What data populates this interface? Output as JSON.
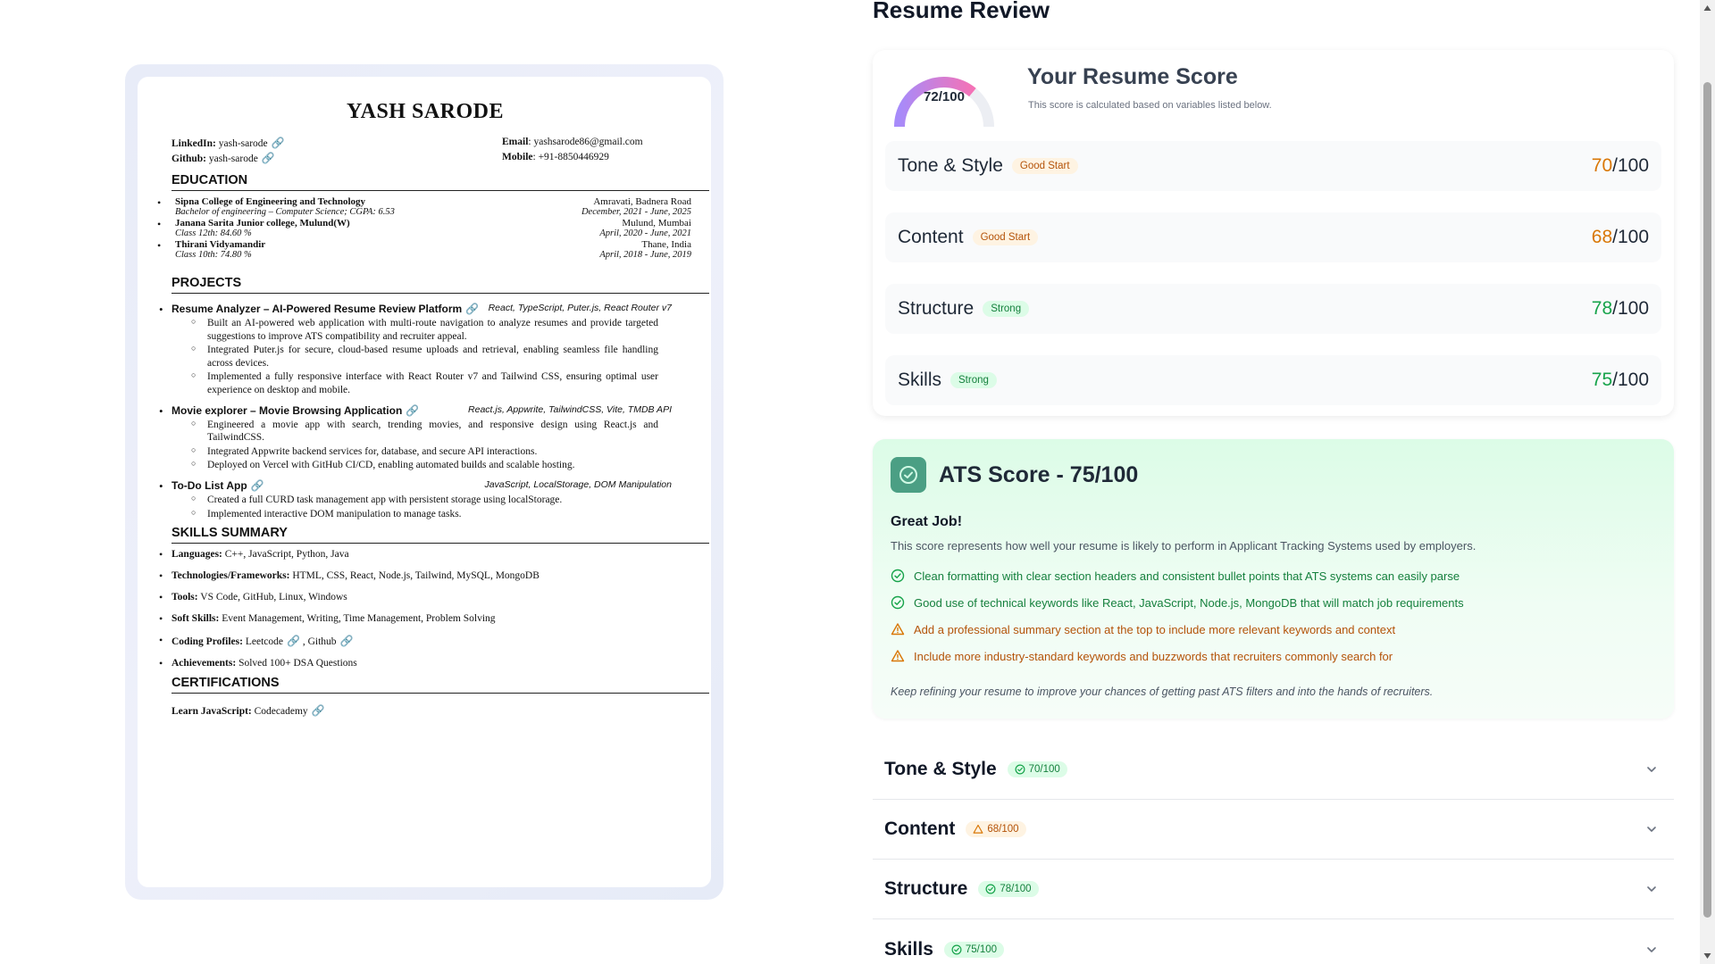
{
  "resume": {
    "name": "YASH SARODE",
    "contact": {
      "linkedin_label": "LinkedIn:",
      "linkedin_value": "yash-sarode",
      "github_label": "Github:",
      "github_value": "yash-sarode",
      "email_label": "Email",
      "email_value": ": yashsarode86@gmail.com",
      "mobile_label": "Mobile",
      "mobile_value": ": +91-8850446929"
    },
    "sections": {
      "education": "EDUCATION",
      "projects": "PROJECTS",
      "skills": "SKILLS SUMMARY",
      "certifications": "CERTIFICATIONS"
    },
    "education": [
      {
        "school": "Sipna College of Engineering and Technology",
        "place": "Amravati, Badnera Road",
        "detail": "Bachelor of engineering – Computer Science; CGPA: 6.53",
        "dates": "December, 2021 - June, 2025"
      },
      {
        "school": "Janana Sarita Junior college, Mulund(W)",
        "place": "Mulund, Mumbai",
        "detail": "Class 12th: 84.60 %",
        "dates": "April, 2020 - June, 2021"
      },
      {
        "school": "Thirani Vidyamandir",
        "place": "Thane, India",
        "detail": "Class 10th: 74.80 %",
        "dates": "April, 2018 - June, 2019"
      }
    ],
    "projects": [
      {
        "title": "Resume Analyzer – AI-Powered Resume Review Platform",
        "tech": "React, TypeScript, Puter.js, React Router v7",
        "bullets": [
          "Built an AI-powered web application with multi-route navigation to analyze resumes and provide targeted suggestions to improve ATS compatibility and recruiter appeal.",
          "Integrated Puter.js for secure, cloud-based resume uploads and retrieval, enabling seamless file handling across devices.",
          "Implemented a fully responsive interface with React Router v7 and Tailwind CSS, ensuring optimal user experience on desktop and mobile."
        ]
      },
      {
        "title": "Movie explorer – Movie Browsing Application",
        "tech": "React.js, Appwrite, TailwindCSS, Vite, TMDB API",
        "bullets": [
          "Engineered a movie app with search, trending movies, and responsive design using React.js and TailwindCSS.",
          "Integrated Appwrite backend services for, database, and secure API interactions.",
          "Deployed on Vercel with GitHub CI/CD, enabling automated builds and scalable hosting."
        ]
      },
      {
        "title": "To-Do List App",
        "tech": "JavaScript, LocalStorage, DOM Manipulation",
        "bullets": [
          "Created a full CURD task management app with persistent storage using localStorage.",
          "Implemented interactive DOM manipulation to manage tasks."
        ]
      }
    ],
    "skills": [
      {
        "label": "Languages:",
        "value": " C++, JavaScript, Python, Java"
      },
      {
        "label": "Technologies/Frameworks:",
        "value": " HTML, CSS, React, Node.js, Tailwind, MySQL, MongoDB"
      },
      {
        "label": "Tools:",
        "value": " VS Code, GitHub, Linux, Windows"
      },
      {
        "label": "Soft Skills:",
        "value": " Event Management, Writing, Time Management, Problem Solving"
      },
      {
        "label": "Coding Profiles:",
        "value": "  Leetcode",
        "extra": " , Github"
      },
      {
        "label": "Achievements:",
        "value": "  Solved 100+ DSA Questions"
      }
    ],
    "certification": {
      "label": "Learn JavaScript:",
      "value": " Codecademy"
    }
  },
  "review": {
    "page_title": "Resume Review",
    "summary": {
      "score_value": 72,
      "score_max": 100,
      "score_label": "72/100",
      "title": "Your Resume Score",
      "subtitle": "This score is calculated based on variables listed below.",
      "categories": [
        {
          "name": "Tone & Style",
          "badge": "Good Start",
          "status": "warn",
          "score": "70",
          "max": "/100"
        },
        {
          "name": "Content",
          "badge": "Good Start",
          "status": "warn",
          "score": "68",
          "max": "/100"
        },
        {
          "name": "Structure",
          "badge": "Strong",
          "status": "good",
          "score": "78",
          "max": "/100"
        },
        {
          "name": "Skills",
          "badge": "Strong",
          "status": "good",
          "score": "75",
          "max": "/100"
        }
      ]
    },
    "ats": {
      "title": "ATS Score - 75/100",
      "heading": "Great Job!",
      "description": "This score represents how well your resume is likely to perform in Applicant Tracking Systems used by employers.",
      "tips": [
        {
          "type": "good",
          "text": "Clean formatting with clear section headers and consistent bullet points that ATS systems can easily parse"
        },
        {
          "type": "good",
          "text": "Good use of technical keywords like React, JavaScript, Node.js, MongoDB that will match job requirements"
        },
        {
          "type": "warn",
          "text": "Add a professional summary section at the top to include more relevant keywords and context"
        },
        {
          "type": "warn",
          "text": "Include more industry-standard keywords and buzzwords that recruiters commonly search for"
        }
      ],
      "footer": "Keep refining your resume to improve your chances of getting past ATS filters and into the hands of recruiters."
    },
    "accordion": [
      {
        "title": "Tone & Style",
        "badge": "70/100",
        "status": "good"
      },
      {
        "title": "Content",
        "badge": "68/100",
        "status": "warn"
      },
      {
        "title": "Structure",
        "badge": "78/100",
        "status": "good"
      },
      {
        "title": "Skills",
        "badge": "75/100",
        "status": "good"
      }
    ]
  },
  "colors": {
    "good": "#16a34a",
    "warn": "#d97706",
    "accent_green": "#4b9f84"
  },
  "icons": [
    "link-icon",
    "check-circle-icon",
    "warning-triangle-icon",
    "chevron-down-icon",
    "ats-badge-icon"
  ]
}
